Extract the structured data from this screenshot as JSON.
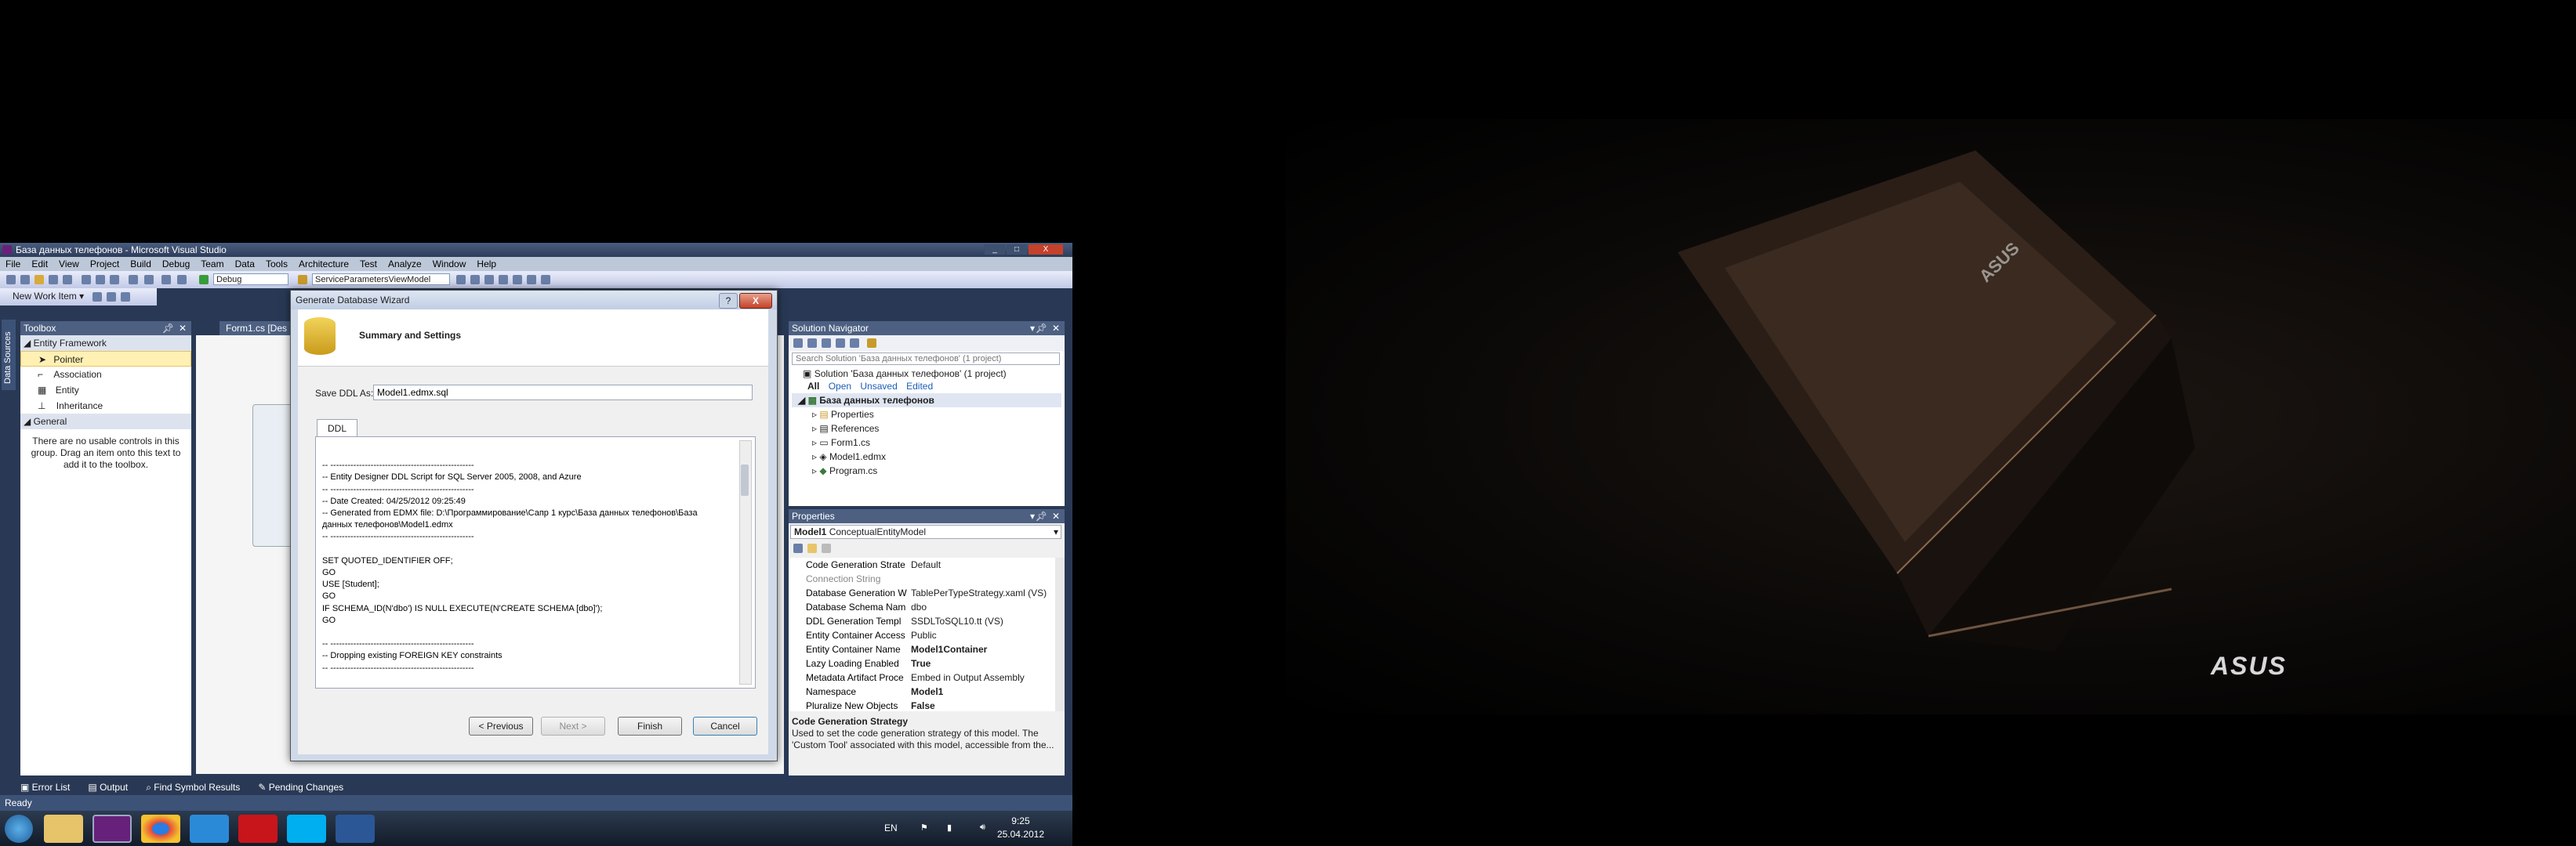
{
  "window": {
    "title": "База данных телефонов - Microsoft Visual Studio",
    "controls": [
      "_",
      "□",
      "X"
    ]
  },
  "menu": [
    "File",
    "Edit",
    "View",
    "Project",
    "Build",
    "Debug",
    "Team",
    "Data",
    "Tools",
    "Architecture",
    "Test",
    "Analyze",
    "Window",
    "Help"
  ],
  "toolbar": {
    "config": "Debug",
    "startup": "ServiceParametersViewModel",
    "new_work_item": "New Work Item ▾"
  },
  "toolbox": {
    "title": "Toolbox",
    "side_tab": "Data Sources",
    "category1": "Entity Framework",
    "items": [
      "Pointer",
      "Association",
      "Entity",
      "Inheritance"
    ],
    "category2": "General",
    "empty_msg": "There are no usable controls in this group. Drag an item onto this text to add it to the toolbox."
  },
  "editor_tab": "Form1.cs [Des",
  "dialog": {
    "title": "Generate Database Wizard",
    "help": "?",
    "close": "X",
    "heading": "Summary and Settings",
    "save_label": "Save DDL As:",
    "save_value": "Model1.edmx.sql",
    "tab": "DDL",
    "ddl_lines": [
      "",
      "-- --------------------------------------------------",
      "-- Entity Designer DDL Script for SQL Server 2005, 2008, and Azure",
      "-- --------------------------------------------------",
      "-- Date Created: 04/25/2012 09:25:49",
      "-- Generated from EDMX file: D:\\Программирование\\Сапр 1 курс\\База данных телефонов\\База",
      "данных телефонов\\Model1.edmx",
      "-- --------------------------------------------------",
      "",
      "SET QUOTED_IDENTIFIER OFF;",
      "GO",
      "USE [Student];",
      "GO",
      "IF SCHEMA_ID(N'dbo') IS NULL EXECUTE(N'CREATE SCHEMA [dbo]');",
      "GO",
      "",
      "-- --------------------------------------------------",
      "-- Dropping existing FOREIGN KEY constraints",
      "-- --------------------------------------------------"
    ],
    "buttons": {
      "previous": "< Previous",
      "next": "Next >",
      "finish": "Finish",
      "cancel": "Cancel"
    }
  },
  "solution_navigator": {
    "title": "Solution Navigator",
    "search_placeholder": "Search Solution 'База данных телефонов' (1 project)",
    "solution": "Solution 'База данных телефонов' (1 project)",
    "filters": [
      "All",
      "Open",
      "Unsaved",
      "Edited"
    ],
    "project": "База данных телефонов",
    "items": [
      "Properties",
      "References",
      "Form1.cs",
      "Model1.edmx",
      "Program.cs"
    ]
  },
  "properties": {
    "title": "Properties",
    "object_name": "Model1",
    "object_type": "ConceptualEntityModel",
    "rows": [
      {
        "name": "Code Generation Strate",
        "value": "Default",
        "bold": false
      },
      {
        "name": "Connection String",
        "value": "",
        "bold": false,
        "gray": true
      },
      {
        "name": "Database Generation W",
        "value": "TablePerTypeStrategy.xaml (VS)",
        "bold": false
      },
      {
        "name": "Database Schema Nam",
        "value": "dbo",
        "bold": false
      },
      {
        "name": "DDL Generation Templ",
        "value": "SSDLToSQL10.tt (VS)",
        "bold": false
      },
      {
        "name": "Entity Container Access",
        "value": "Public",
        "bold": false
      },
      {
        "name": "Entity Container Name",
        "value": "Model1Container",
        "bold": true
      },
      {
        "name": "Lazy Loading Enabled",
        "value": "True",
        "bold": true
      },
      {
        "name": "Metadata Artifact Proce",
        "value": "Embed in Output Assembly",
        "bold": false
      },
      {
        "name": "Namespace",
        "value": "Model1",
        "bold": true
      },
      {
        "name": "Pluralize New Objects",
        "value": "False",
        "bold": true
      }
    ],
    "desc_title": "Code Generation Strategy",
    "desc_text": "Used to set the code generation strategy of this model. The 'Custom Tool' associated with this model, accessible from the..."
  },
  "bottom_tabs": [
    "Error List",
    "Output",
    "Find Symbol Results",
    "Pending Changes"
  ],
  "status": "Ready",
  "taskbar": {
    "lang": "EN",
    "time": "9:25",
    "date": "25.04.2012",
    "apps": [
      "explorer-icon",
      "visual-studio-icon",
      "chrome-icon",
      "ie-icon",
      "acrobat-icon",
      "skype-icon",
      "word-icon"
    ]
  },
  "wallpaper": {
    "brand": "ASUS"
  },
  "colors": {
    "vs_frame": "#293955",
    "active_header": "#f2d680",
    "wallpaper_bg": "#0a0807"
  }
}
